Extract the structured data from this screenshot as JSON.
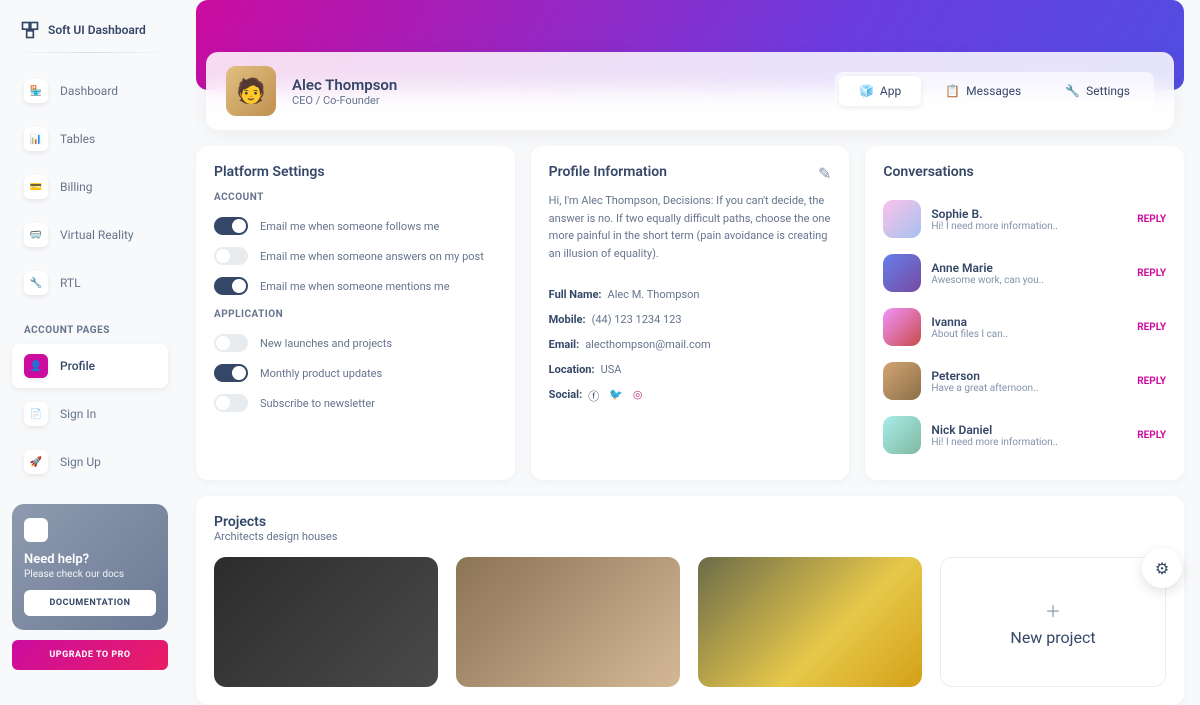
{
  "brand": "Soft UI Dashboard",
  "nav": {
    "items": [
      {
        "icon": "🏪",
        "label": "Dashboard"
      },
      {
        "icon": "📊",
        "label": "Tables"
      },
      {
        "icon": "💳",
        "label": "Billing"
      },
      {
        "icon": "🥽",
        "label": "Virtual Reality"
      },
      {
        "icon": "🔧",
        "label": "RTL"
      }
    ],
    "section": "ACCOUNT PAGES",
    "pages": [
      {
        "icon": "👤",
        "label": "Profile"
      },
      {
        "icon": "📄",
        "label": "Sign In"
      },
      {
        "icon": "🚀",
        "label": "Sign Up"
      }
    ]
  },
  "help": {
    "title": "Need help?",
    "sub": "Please check our docs",
    "btn": "DOCUMENTATION"
  },
  "upgrade": "UPGRADE TO PRO",
  "profile": {
    "name": "Alec Thompson",
    "role": "CEO / Co-Founder"
  },
  "tabs": {
    "app": "App",
    "msg": "Messages",
    "set": "Settings"
  },
  "settings": {
    "title": "Platform Settings",
    "acc": "ACCOUNT",
    "app": "APPLICATION",
    "items": [
      {
        "on": true,
        "label": "Email me when someone follows me"
      },
      {
        "on": false,
        "label": "Email me when someone answers on my post"
      },
      {
        "on": true,
        "label": "Email me when someone mentions me"
      }
    ],
    "items2": [
      {
        "on": false,
        "label": "New launches and projects"
      },
      {
        "on": true,
        "label": "Monthly product updates"
      },
      {
        "on": false,
        "label": "Subscribe to newsletter"
      }
    ]
  },
  "info": {
    "title": "Profile Information",
    "bio": "Hi, I'm Alec Thompson, Decisions: If you can't decide, the answer is no. If two equally difficult paths, choose the one more painful in the short term (pain avoidance is creating an illusion of equality).",
    "rows": {
      "name_k": "Full Name:",
      "name_v": "Alec M. Thompson",
      "mob_k": "Mobile:",
      "mob_v": "(44) 123 1234 123",
      "em_k": "Email:",
      "em_v": "alecthompson@mail.com",
      "loc_k": "Location:",
      "loc_v": "USA",
      "soc_k": "Social:"
    }
  },
  "conv": {
    "title": "Conversations",
    "reply": "REPLY",
    "items": [
      {
        "name": "Sophie B.",
        "msg": "Hi! I need more information.."
      },
      {
        "name": "Anne Marie",
        "msg": "Awesome work, can you.."
      },
      {
        "name": "Ivanna",
        "msg": "About files I can.."
      },
      {
        "name": "Peterson",
        "msg": "Have a great afternoon.."
      },
      {
        "name": "Nick Daniel",
        "msg": "Hi! I need more information.."
      }
    ]
  },
  "projects": {
    "title": "Projects",
    "sub": "Architects design houses",
    "new": "New project"
  }
}
